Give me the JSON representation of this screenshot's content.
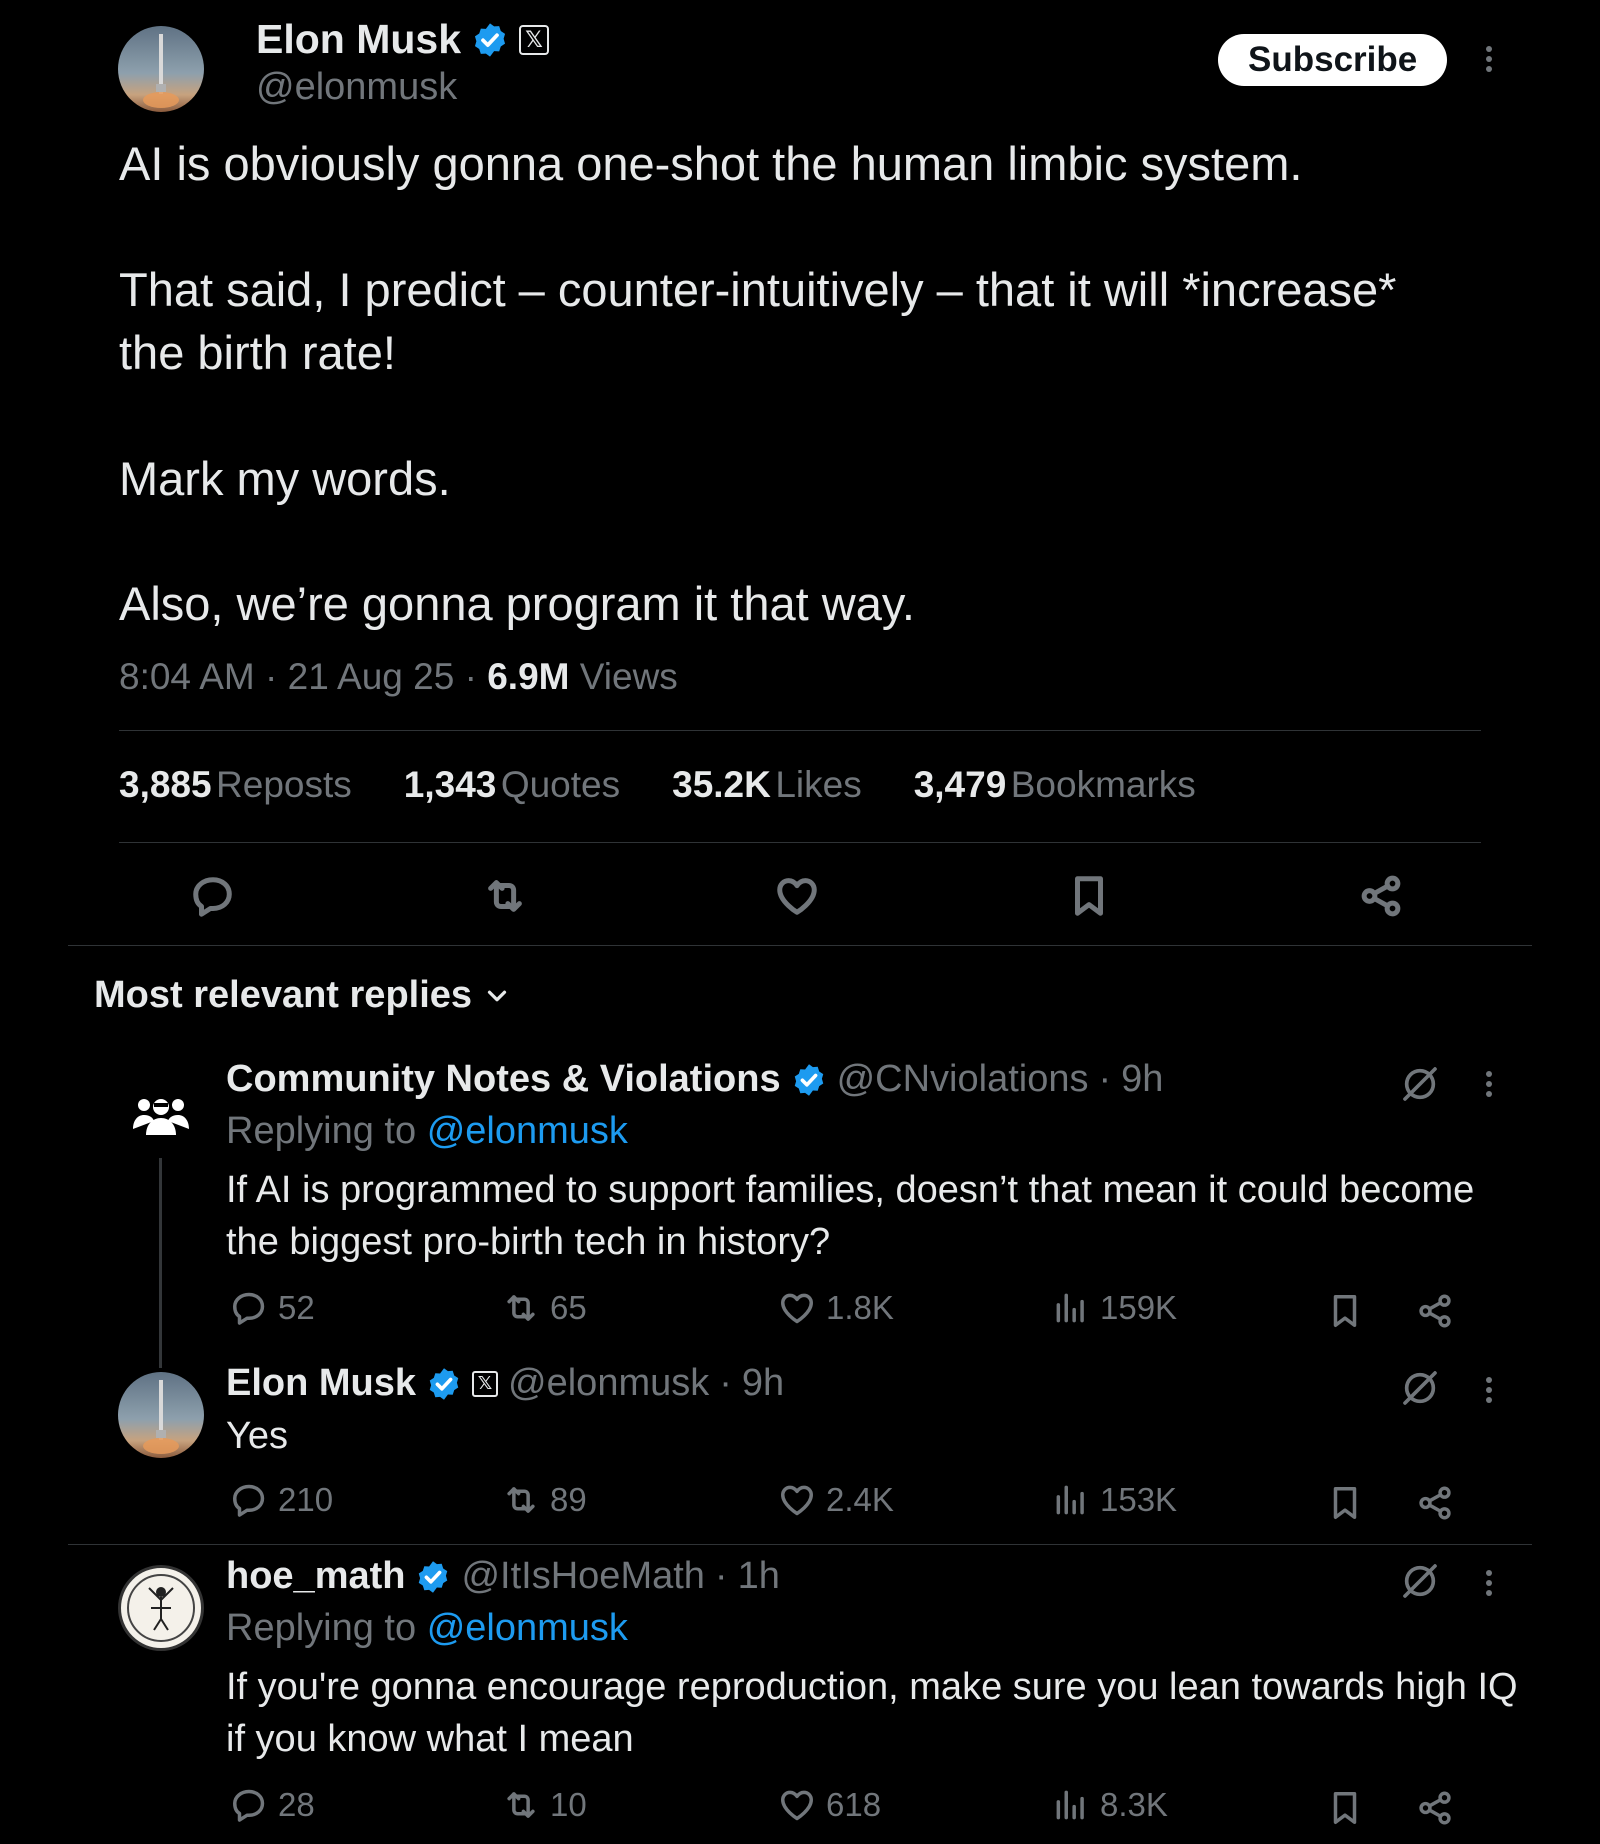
{
  "tweet": {
    "author_name": "Elon Musk",
    "author_handle": "@elonmusk",
    "x_badge": "𝕏",
    "subscribe_label": "Subscribe",
    "paragraphs": [
      "AI is obviously gonna one-shot the human limbic system.",
      "That said, I predict – counter-intuitively – that it will *increase* the birth rate!",
      "Mark my words.",
      "Also, we’re gonna program it that way."
    ],
    "time": "8:04 AM",
    "date": "21 Aug 25",
    "views_count": "6.9M",
    "views_label": "Views",
    "stats": [
      {
        "count": "3,885",
        "label": "Reposts"
      },
      {
        "count": "1,343",
        "label": "Quotes"
      },
      {
        "count": "35.2K",
        "label": "Likes"
      },
      {
        "count": "3,479",
        "label": "Bookmarks"
      }
    ]
  },
  "replies_sort": {
    "label": "Most relevant replies"
  },
  "replies": [
    {
      "name": "Community Notes & Violations",
      "handle": "@CNviolations",
      "age": "9h",
      "replying_prefix": "Replying to",
      "replying_to": "@elonmusk",
      "text": "If AI is programmed to support families, doesn’t that mean it could become the biggest pro-birth tech in history?",
      "replies": "52",
      "reposts": "65",
      "likes": "1.8K",
      "views": "159K"
    },
    {
      "name": "Elon Musk",
      "handle": "@elonmusk",
      "age": "9h",
      "x_badge": "𝕏",
      "text": "Yes",
      "replies": "210",
      "reposts": "89",
      "likes": "2.4K",
      "views": "153K"
    },
    {
      "name": "hoe_math",
      "handle": "@ItIsHoeMath",
      "age": "1h",
      "replying_prefix": "Replying to",
      "replying_to": "@elonmusk",
      "text": "If you're gonna encourage reproduction, make sure you lean towards high IQ if you know what I mean",
      "replies": "28",
      "reposts": "10",
      "likes": "618",
      "views": "8.3K"
    }
  ],
  "colors": {
    "background": "#000000",
    "text": "#e7e9ea",
    "muted": "#71767b",
    "link": "#1d9bf0",
    "verified": "#1d9bf0",
    "divider": "#2f3336"
  },
  "icons": [
    "verified-badge-icon",
    "more-icon",
    "reply-icon",
    "repost-icon",
    "like-icon",
    "bookmark-icon",
    "share-icon",
    "views-icon",
    "grok-icon",
    "chevron-down-icon"
  ]
}
